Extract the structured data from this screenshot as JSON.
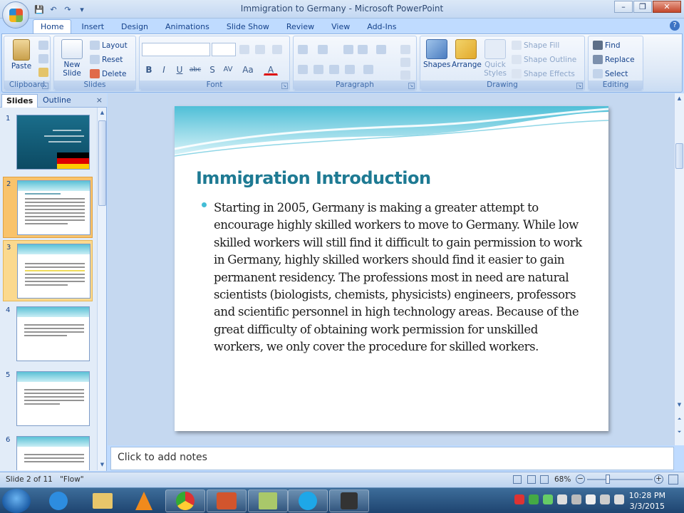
{
  "window": {
    "title": "Immigration to Germany - Microsoft PowerPoint",
    "minimize": "–",
    "restore": "❐",
    "close": "✕"
  },
  "qat": {
    "save_icon": "💾",
    "undo_icon": "↶",
    "redo_icon": "↷",
    "customize_icon": "▾"
  },
  "tabs": [
    "Home",
    "Insert",
    "Design",
    "Animations",
    "Slide Show",
    "Review",
    "View",
    "Add-Ins"
  ],
  "ribbon": {
    "clipboard": {
      "label": "Clipboard",
      "paste": "Paste"
    },
    "slides": {
      "label": "Slides",
      "new_slide": "New",
      "new_slide2": "Slide",
      "layout": "Layout",
      "reset": "Reset",
      "delete": "Delete"
    },
    "font": {
      "label": "Font",
      "bold": "B",
      "italic": "I",
      "underline": "U",
      "strike": "abc",
      "shadow": "S",
      "spacing": "AV",
      "case": "Aa",
      "color": "A"
    },
    "paragraph": {
      "label": "Paragraph"
    },
    "drawing": {
      "label": "Drawing",
      "shapes": "Shapes",
      "arrange": "Arrange",
      "quick": "Quick",
      "styles": "Styles",
      "shape_fill": "Shape Fill",
      "shape_outline": "Shape Outline",
      "shape_effects": "Shape Effects"
    },
    "editing": {
      "label": "Editing",
      "find": "Find",
      "replace": "Replace",
      "select": "Select"
    }
  },
  "pane": {
    "tab_slides": "Slides",
    "tab_outline": "Outline",
    "close": "×",
    "thumb_numbers": [
      "1",
      "2",
      "3",
      "4",
      "5",
      "6"
    ]
  },
  "slide": {
    "title": "Immigration Introduction",
    "body": "Starting in 2005, Germany is making a greater attempt to encourage highly skilled workers to move to Germany. While low skilled workers will still find it difficult to gain permission to work in Germany, highly skilled workers should find it easier to gain permanent residency. The professions most in need are natural scientists (biologists, chemists, physicists) engineers, professors and scientific personnel in high technology areas. Because of the great difficulty of obtaining work permission for unskilled workers, we only cover the procedure for skilled workers."
  },
  "notes": {
    "placeholder": "Click to add notes"
  },
  "status": {
    "slide_info": "Slide 2 of 11",
    "theme": "\"Flow\"",
    "zoom": "68%",
    "zoom_minus": "−",
    "zoom_plus": "+"
  },
  "taskbar": {
    "time": "10:28 PM",
    "date": "3/3/2015"
  },
  "colors": {
    "accent": "#1e7a93",
    "bullet": "#43bdd6",
    "ribbon": "#dbe7f6"
  }
}
